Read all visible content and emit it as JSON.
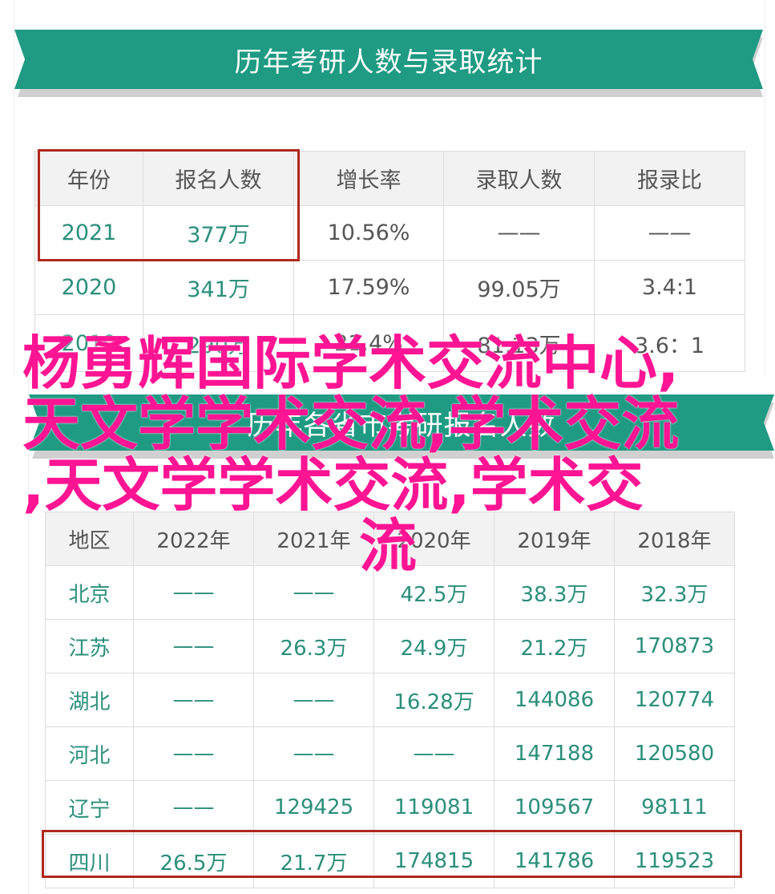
{
  "banner1": {
    "title": "历年考研人数与录取统计"
  },
  "table1": {
    "headers": [
      "年份",
      "报名人数",
      "增长率",
      "录取人数",
      "报录比"
    ],
    "rows": [
      [
        "2021",
        "377万",
        "10.56%",
        "——",
        "——"
      ],
      [
        "2020",
        "341万",
        "17.59%",
        "99.05万",
        "3.4:1"
      ],
      [
        "2019",
        "290万",
        "21.4%",
        "81.13万",
        "3.6：1"
      ]
    ]
  },
  "banner2": {
    "title": "历年各省市考研报名人数"
  },
  "table2": {
    "headers": [
      "地区",
      "2022年",
      "2021年",
      "2020年",
      "2019年",
      "2018年"
    ],
    "rows": [
      [
        "北京",
        "——",
        "——",
        "42.5万",
        "38.3万",
        "32.3万"
      ],
      [
        "江苏",
        "——",
        "26.3万",
        "24.9万",
        "21.2万",
        "170873"
      ],
      [
        "湖北",
        "——",
        "——",
        "16.28万",
        "144086",
        "120774"
      ],
      [
        "河北",
        "——",
        "——",
        "——",
        "147188",
        "120580"
      ],
      [
        "辽宁",
        "——",
        "129425",
        "119081",
        "109567",
        "98111"
      ],
      [
        "四川",
        "26.5万",
        "21.7万",
        "174815",
        "141786",
        "119523"
      ]
    ]
  },
  "overlay": {
    "line1": "杨勇辉国际学术交流中心,",
    "line2": "天文学学术交流,学术交流",
    "line3": ",天文学学术交流,学术交",
    "line4": "流"
  },
  "colors": {
    "teal": "#1f9a83",
    "highlight": "#b0281c",
    "overlay": "#ff1493"
  }
}
